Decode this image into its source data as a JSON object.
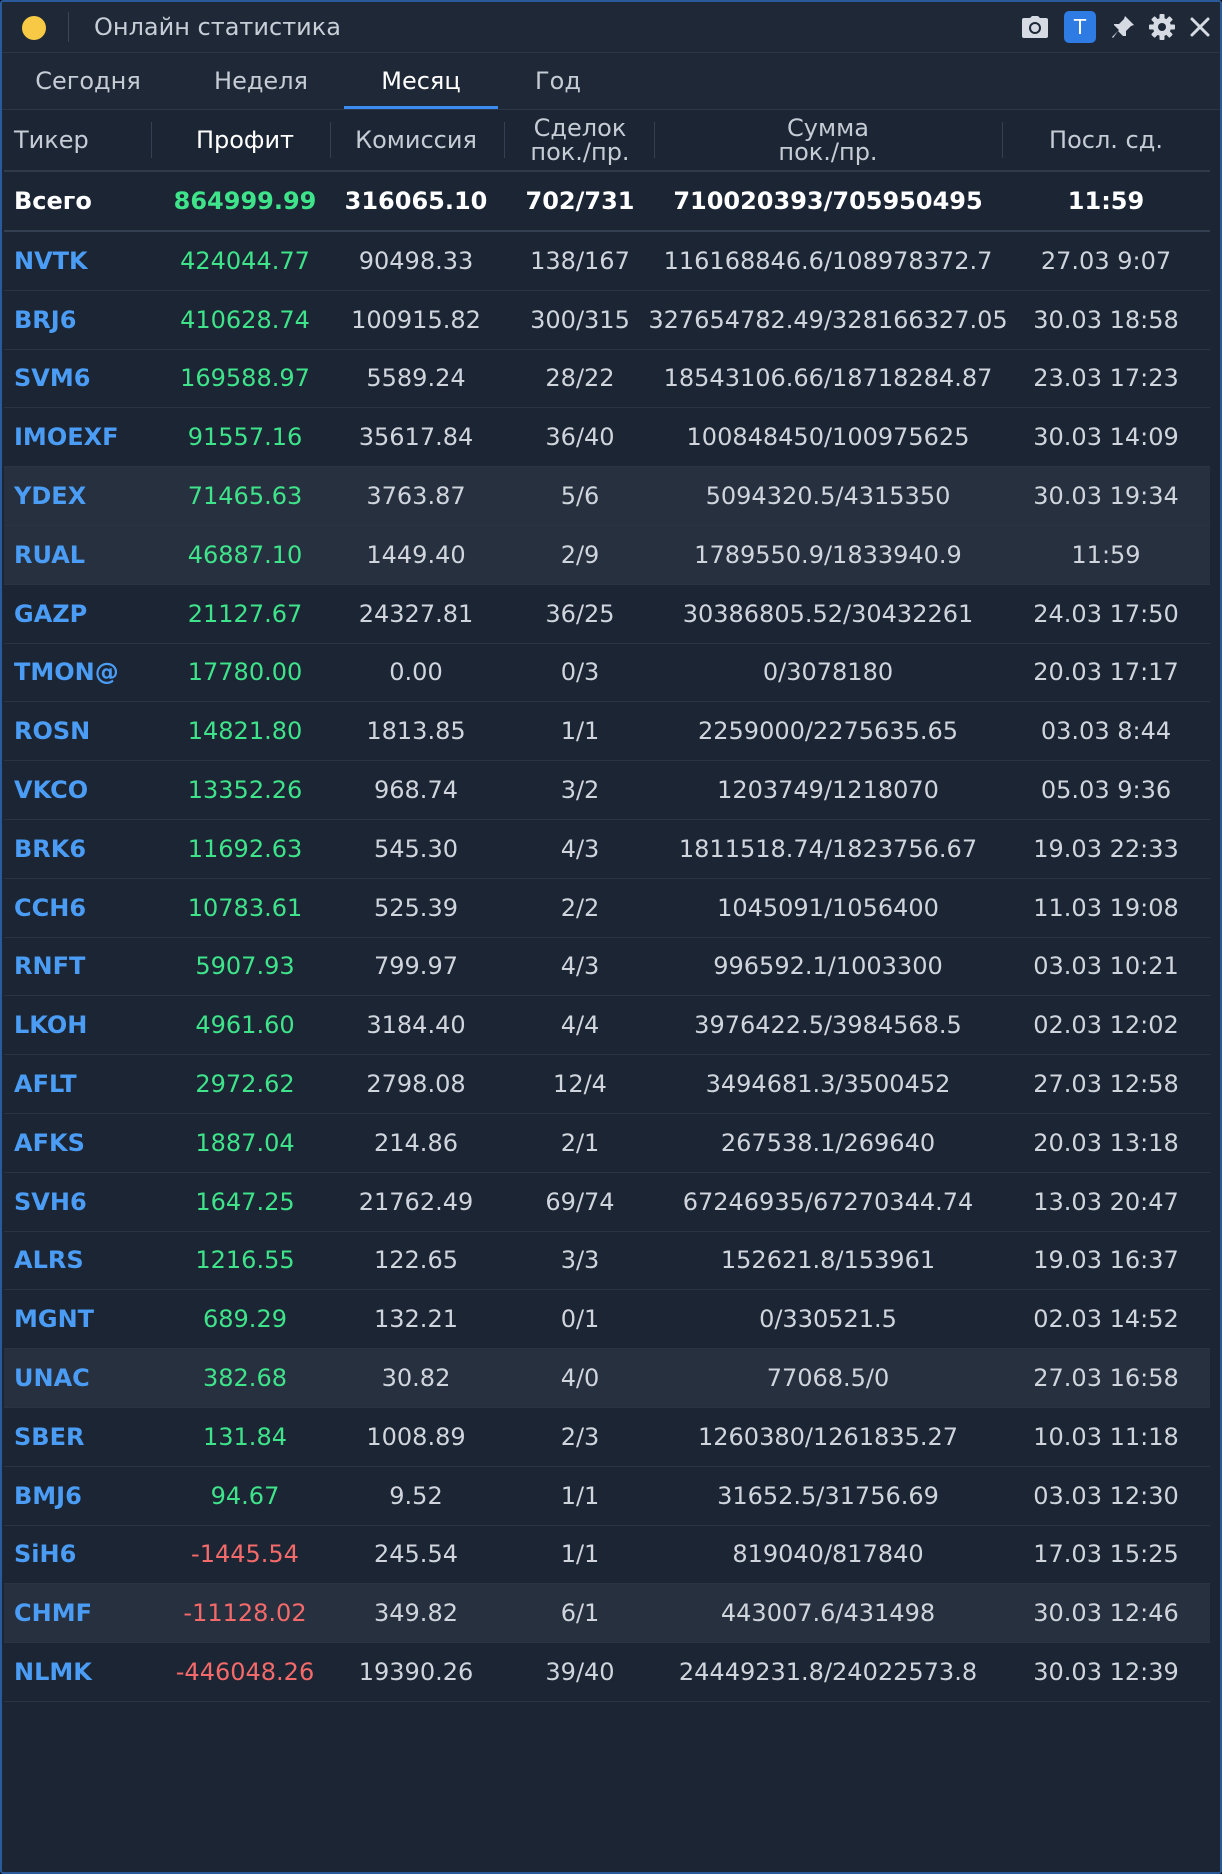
{
  "window": {
    "title": "Онлайн статистика",
    "badge_letter": "T",
    "colors": {
      "background": "#1b2533",
      "accent": "#3a8cf0",
      "positive": "#3ee38a",
      "negative": "#f46a6a",
      "ticker": "#4b9cf5",
      "app_dot": "#f7c945"
    },
    "icons": [
      "camera-icon",
      "t-badge-icon",
      "pin-icon",
      "gear-icon",
      "close-icon"
    ]
  },
  "tabs": [
    {
      "label": "Сегодня",
      "active": false
    },
    {
      "label": "Неделя",
      "active": false
    },
    {
      "label": "Месяц",
      "active": true
    },
    {
      "label": "Год",
      "active": false
    }
  ],
  "columns": {
    "ticker": "Тикер",
    "profit": "Профит",
    "commission": "Комиссия",
    "deals_1": "Сделок",
    "deals_2": "пок./пр.",
    "sum_1": "Сумма",
    "sum_2": "пок./пр.",
    "last": "Посл. сд."
  },
  "total": {
    "ticker": "Всего",
    "profit": "864999.99",
    "commission": "316065.10",
    "deals": "702/731",
    "sum": "710020393/705950495",
    "last": "11:59"
  },
  "rows": [
    {
      "ticker": "NVTK",
      "profit": "424044.77",
      "commission": "90498.33",
      "deals": "138/167",
      "sum": "116168846.6/108978372.7",
      "last": "27.03 9:07",
      "sign": "pos",
      "hl": false
    },
    {
      "ticker": "BRJ6",
      "profit": "410628.74",
      "commission": "100915.82",
      "deals": "300/315",
      "sum": "327654782.49/328166327.05",
      "last": "30.03 18:58",
      "sign": "pos",
      "hl": false
    },
    {
      "ticker": "SVM6",
      "profit": "169588.97",
      "commission": "5589.24",
      "deals": "28/22",
      "sum": "18543106.66/18718284.87",
      "last": "23.03 17:23",
      "sign": "pos",
      "hl": false
    },
    {
      "ticker": "IMOEXF",
      "profit": "91557.16",
      "commission": "35617.84",
      "deals": "36/40",
      "sum": "100848450/100975625",
      "last": "30.03 14:09",
      "sign": "pos",
      "hl": false
    },
    {
      "ticker": "YDEX",
      "profit": "71465.63",
      "commission": "3763.87",
      "deals": "5/6",
      "sum": "5094320.5/4315350",
      "last": "30.03 19:34",
      "sign": "pos",
      "hl": true
    },
    {
      "ticker": "RUAL",
      "profit": "46887.10",
      "commission": "1449.40",
      "deals": "2/9",
      "sum": "1789550.9/1833940.9",
      "last": "11:59",
      "sign": "pos",
      "hl": true
    },
    {
      "ticker": "GAZP",
      "profit": "21127.67",
      "commission": "24327.81",
      "deals": "36/25",
      "sum": "30386805.52/30432261",
      "last": "24.03 17:50",
      "sign": "pos",
      "hl": false
    },
    {
      "ticker": "TMON@",
      "profit": "17780.00",
      "commission": "0.00",
      "deals": "0/3",
      "sum": "0/3078180",
      "last": "20.03 17:17",
      "sign": "pos",
      "hl": false
    },
    {
      "ticker": "ROSN",
      "profit": "14821.80",
      "commission": "1813.85",
      "deals": "1/1",
      "sum": "2259000/2275635.65",
      "last": "03.03 8:44",
      "sign": "pos",
      "hl": false
    },
    {
      "ticker": "VKCO",
      "profit": "13352.26",
      "commission": "968.74",
      "deals": "3/2",
      "sum": "1203749/1218070",
      "last": "05.03 9:36",
      "sign": "pos",
      "hl": false
    },
    {
      "ticker": "BRK6",
      "profit": "11692.63",
      "commission": "545.30",
      "deals": "4/3",
      "sum": "1811518.74/1823756.67",
      "last": "19.03 22:33",
      "sign": "pos",
      "hl": false
    },
    {
      "ticker": "CCH6",
      "profit": "10783.61",
      "commission": "525.39",
      "deals": "2/2",
      "sum": "1045091/1056400",
      "last": "11.03 19:08",
      "sign": "pos",
      "hl": false
    },
    {
      "ticker": "RNFT",
      "profit": "5907.93",
      "commission": "799.97",
      "deals": "4/3",
      "sum": "996592.1/1003300",
      "last": "03.03 10:21",
      "sign": "pos",
      "hl": false
    },
    {
      "ticker": "LKOH",
      "profit": "4961.60",
      "commission": "3184.40",
      "deals": "4/4",
      "sum": "3976422.5/3984568.5",
      "last": "02.03 12:02",
      "sign": "pos",
      "hl": false
    },
    {
      "ticker": "AFLT",
      "profit": "2972.62",
      "commission": "2798.08",
      "deals": "12/4",
      "sum": "3494681.3/3500452",
      "last": "27.03 12:58",
      "sign": "pos",
      "hl": false
    },
    {
      "ticker": "AFKS",
      "profit": "1887.04",
      "commission": "214.86",
      "deals": "2/1",
      "sum": "267538.1/269640",
      "last": "20.03 13:18",
      "sign": "pos",
      "hl": false
    },
    {
      "ticker": "SVH6",
      "profit": "1647.25",
      "commission": "21762.49",
      "deals": "69/74",
      "sum": "67246935/67270344.74",
      "last": "13.03 20:47",
      "sign": "pos",
      "hl": false
    },
    {
      "ticker": "ALRS",
      "profit": "1216.55",
      "commission": "122.65",
      "deals": "3/3",
      "sum": "152621.8/153961",
      "last": "19.03 16:37",
      "sign": "pos",
      "hl": false
    },
    {
      "ticker": "MGNT",
      "profit": "689.29",
      "commission": "132.21",
      "deals": "0/1",
      "sum": "0/330521.5",
      "last": "02.03 14:52",
      "sign": "pos",
      "hl": false
    },
    {
      "ticker": "UNAC",
      "profit": "382.68",
      "commission": "30.82",
      "deals": "4/0",
      "sum": "77068.5/0",
      "last": "27.03 16:58",
      "sign": "pos",
      "hl": true
    },
    {
      "ticker": "SBER",
      "profit": "131.84",
      "commission": "1008.89",
      "deals": "2/3",
      "sum": "1260380/1261835.27",
      "last": "10.03 11:18",
      "sign": "pos",
      "hl": false
    },
    {
      "ticker": "BMJ6",
      "profit": "94.67",
      "commission": "9.52",
      "deals": "1/1",
      "sum": "31652.5/31756.69",
      "last": "03.03 12:30",
      "sign": "pos",
      "hl": false
    },
    {
      "ticker": "SiH6",
      "profit": "-1445.54",
      "commission": "245.54",
      "deals": "1/1",
      "sum": "819040/817840",
      "last": "17.03 15:25",
      "sign": "neg",
      "hl": false
    },
    {
      "ticker": "CHMF",
      "profit": "-11128.02",
      "commission": "349.82",
      "deals": "6/1",
      "sum": "443007.6/431498",
      "last": "30.03 12:46",
      "sign": "neg",
      "hl": true
    },
    {
      "ticker": "NLMK",
      "profit": "-446048.26",
      "commission": "19390.26",
      "deals": "39/40",
      "sum": "24449231.8/24022573.8",
      "last": "30.03 12:39",
      "sign": "neg",
      "hl": false
    }
  ]
}
